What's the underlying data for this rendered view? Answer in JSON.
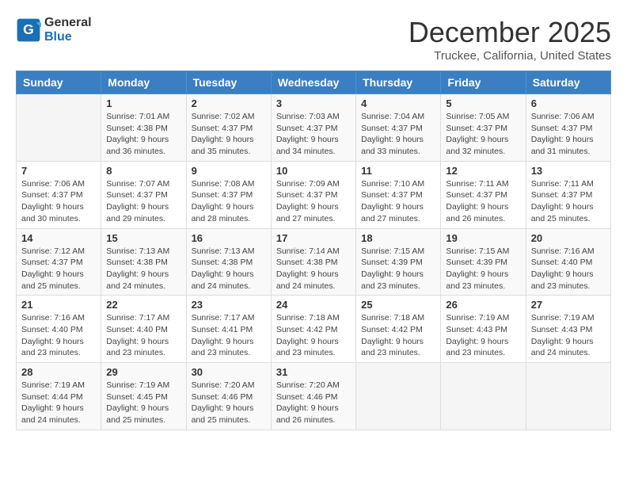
{
  "header": {
    "logo_general": "General",
    "logo_blue": "Blue",
    "month_title": "December 2025",
    "location": "Truckee, California, United States"
  },
  "days_of_week": [
    "Sunday",
    "Monday",
    "Tuesday",
    "Wednesday",
    "Thursday",
    "Friday",
    "Saturday"
  ],
  "weeks": [
    [
      {
        "day": "",
        "sunrise": "",
        "sunset": "",
        "daylight": ""
      },
      {
        "day": "1",
        "sunrise": "7:01 AM",
        "sunset": "4:38 PM",
        "daylight": "9 hours and 36 minutes."
      },
      {
        "day": "2",
        "sunrise": "7:02 AM",
        "sunset": "4:37 PM",
        "daylight": "9 hours and 35 minutes."
      },
      {
        "day": "3",
        "sunrise": "7:03 AM",
        "sunset": "4:37 PM",
        "daylight": "9 hours and 34 minutes."
      },
      {
        "day": "4",
        "sunrise": "7:04 AM",
        "sunset": "4:37 PM",
        "daylight": "9 hours and 33 minutes."
      },
      {
        "day": "5",
        "sunrise": "7:05 AM",
        "sunset": "4:37 PM",
        "daylight": "9 hours and 32 minutes."
      },
      {
        "day": "6",
        "sunrise": "7:06 AM",
        "sunset": "4:37 PM",
        "daylight": "9 hours and 31 minutes."
      }
    ],
    [
      {
        "day": "7",
        "sunrise": "7:06 AM",
        "sunset": "4:37 PM",
        "daylight": "9 hours and 30 minutes."
      },
      {
        "day": "8",
        "sunrise": "7:07 AM",
        "sunset": "4:37 PM",
        "daylight": "9 hours and 29 minutes."
      },
      {
        "day": "9",
        "sunrise": "7:08 AM",
        "sunset": "4:37 PM",
        "daylight": "9 hours and 28 minutes."
      },
      {
        "day": "10",
        "sunrise": "7:09 AM",
        "sunset": "4:37 PM",
        "daylight": "9 hours and 27 minutes."
      },
      {
        "day": "11",
        "sunrise": "7:10 AM",
        "sunset": "4:37 PM",
        "daylight": "9 hours and 27 minutes."
      },
      {
        "day": "12",
        "sunrise": "7:11 AM",
        "sunset": "4:37 PM",
        "daylight": "9 hours and 26 minutes."
      },
      {
        "day": "13",
        "sunrise": "7:11 AM",
        "sunset": "4:37 PM",
        "daylight": "9 hours and 25 minutes."
      }
    ],
    [
      {
        "day": "14",
        "sunrise": "7:12 AM",
        "sunset": "4:37 PM",
        "daylight": "9 hours and 25 minutes."
      },
      {
        "day": "15",
        "sunrise": "7:13 AM",
        "sunset": "4:38 PM",
        "daylight": "9 hours and 24 minutes."
      },
      {
        "day": "16",
        "sunrise": "7:13 AM",
        "sunset": "4:38 PM",
        "daylight": "9 hours and 24 minutes."
      },
      {
        "day": "17",
        "sunrise": "7:14 AM",
        "sunset": "4:38 PM",
        "daylight": "9 hours and 24 minutes."
      },
      {
        "day": "18",
        "sunrise": "7:15 AM",
        "sunset": "4:39 PM",
        "daylight": "9 hours and 23 minutes."
      },
      {
        "day": "19",
        "sunrise": "7:15 AM",
        "sunset": "4:39 PM",
        "daylight": "9 hours and 23 minutes."
      },
      {
        "day": "20",
        "sunrise": "7:16 AM",
        "sunset": "4:40 PM",
        "daylight": "9 hours and 23 minutes."
      }
    ],
    [
      {
        "day": "21",
        "sunrise": "7:16 AM",
        "sunset": "4:40 PM",
        "daylight": "9 hours and 23 minutes."
      },
      {
        "day": "22",
        "sunrise": "7:17 AM",
        "sunset": "4:40 PM",
        "daylight": "9 hours and 23 minutes."
      },
      {
        "day": "23",
        "sunrise": "7:17 AM",
        "sunset": "4:41 PM",
        "daylight": "9 hours and 23 minutes."
      },
      {
        "day": "24",
        "sunrise": "7:18 AM",
        "sunset": "4:42 PM",
        "daylight": "9 hours and 23 minutes."
      },
      {
        "day": "25",
        "sunrise": "7:18 AM",
        "sunset": "4:42 PM",
        "daylight": "9 hours and 23 minutes."
      },
      {
        "day": "26",
        "sunrise": "7:19 AM",
        "sunset": "4:43 PM",
        "daylight": "9 hours and 23 minutes."
      },
      {
        "day": "27",
        "sunrise": "7:19 AM",
        "sunset": "4:43 PM",
        "daylight": "9 hours and 24 minutes."
      }
    ],
    [
      {
        "day": "28",
        "sunrise": "7:19 AM",
        "sunset": "4:44 PM",
        "daylight": "9 hours and 24 minutes."
      },
      {
        "day": "29",
        "sunrise": "7:19 AM",
        "sunset": "4:45 PM",
        "daylight": "9 hours and 25 minutes."
      },
      {
        "day": "30",
        "sunrise": "7:20 AM",
        "sunset": "4:46 PM",
        "daylight": "9 hours and 25 minutes."
      },
      {
        "day": "31",
        "sunrise": "7:20 AM",
        "sunset": "4:46 PM",
        "daylight": "9 hours and 26 minutes."
      },
      {
        "day": "",
        "sunrise": "",
        "sunset": "",
        "daylight": ""
      },
      {
        "day": "",
        "sunrise": "",
        "sunset": "",
        "daylight": ""
      },
      {
        "day": "",
        "sunrise": "",
        "sunset": "",
        "daylight": ""
      }
    ]
  ],
  "labels": {
    "sunrise": "Sunrise:",
    "sunset": "Sunset:",
    "daylight": "Daylight:"
  }
}
